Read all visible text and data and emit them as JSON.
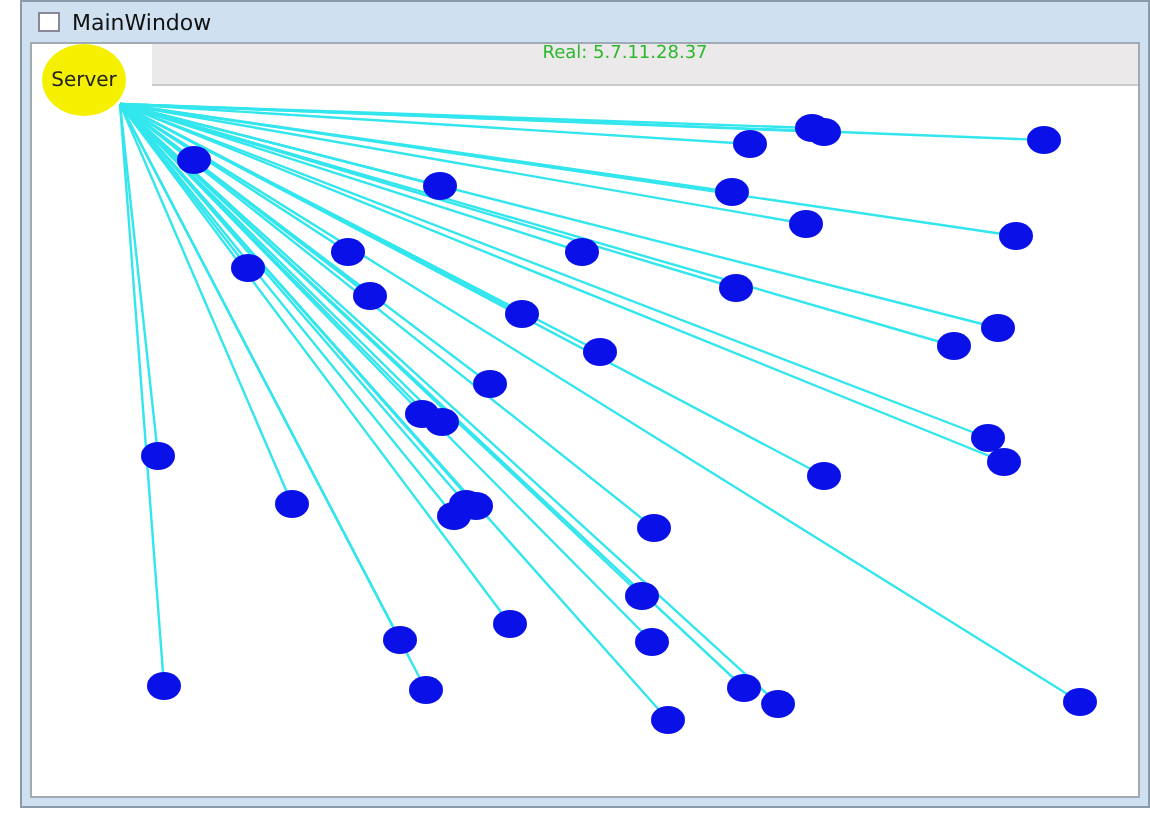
{
  "window": {
    "title": "MainWindow"
  },
  "server": {
    "label": "Server"
  },
  "status": {
    "text": "Real: 5.7.11.28.37"
  }
}
